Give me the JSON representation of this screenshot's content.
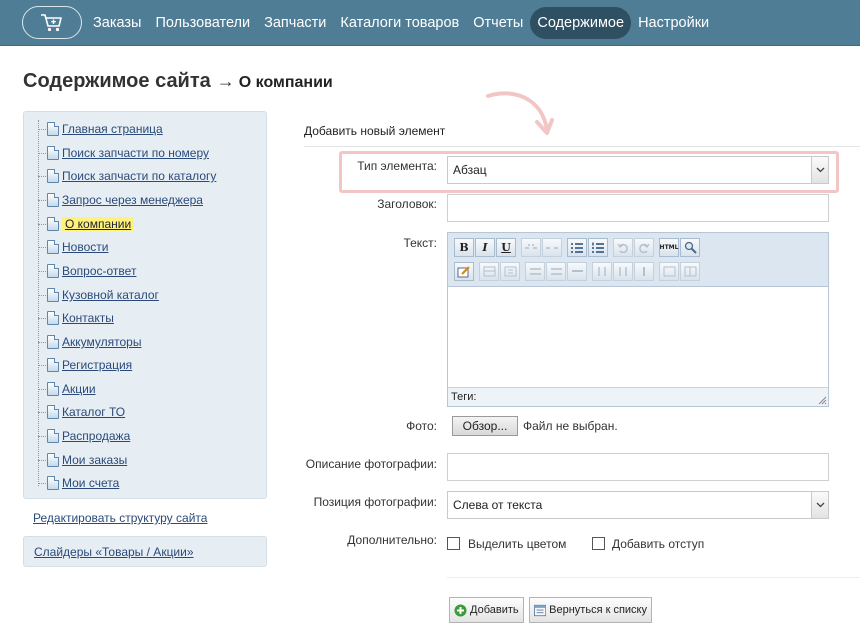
{
  "nav": {
    "cart_icon": "cart-icon",
    "items": [
      {
        "label": "Заказы",
        "active": false
      },
      {
        "label": "Пользователи",
        "active": false
      },
      {
        "label": "Запчасти",
        "active": false
      },
      {
        "label": "Каталоги товаров",
        "active": false
      },
      {
        "label": "Отчеты",
        "active": false
      },
      {
        "label": "Содержимое",
        "active": true
      },
      {
        "label": "Настройки",
        "active": false
      }
    ]
  },
  "title": {
    "main": "Содержимое сайта",
    "arrow": "→",
    "sub": "О компании"
  },
  "sidebar": {
    "tree": [
      {
        "label": "Главная страница"
      },
      {
        "label": "Поиск запчасти по номеру"
      },
      {
        "label": "Поиск запчасти по каталогу"
      },
      {
        "label": "Запрос через менеджера"
      },
      {
        "label": "О компании",
        "current": true
      },
      {
        "label": "Новости"
      },
      {
        "label": "Вопрос-ответ"
      },
      {
        "label": "Кузовной каталог"
      },
      {
        "label": "Контакты"
      },
      {
        "label": "Аккумуляторы"
      },
      {
        "label": "Регистрация"
      },
      {
        "label": "Акции"
      },
      {
        "label": "Каталог ТО"
      },
      {
        "label": "Распродажа"
      },
      {
        "label": "Мои заказы"
      },
      {
        "label": "Мои счета"
      }
    ],
    "edit_structure": "Редактировать структуру сайта",
    "sliders": "Слайдеры «Товары / Акции»"
  },
  "form": {
    "heading": "Добавить новый элемент",
    "type_label": "Тип элемента:",
    "type_value": "Абзац",
    "heading_label": "Заголовок:",
    "heading_value": "",
    "text_label": "Текст:",
    "editor": {
      "bold": "B",
      "italic": "I",
      "underline": "U",
      "html": "HTML",
      "status_label": "Теги:"
    },
    "photo_label": "Фото:",
    "photo_button": "Обзор...",
    "photo_status": "Файл не выбран.",
    "photo_desc_label": "Описание фотографии:",
    "photo_desc_value": "",
    "photo_pos_label": "Позиция фотографии:",
    "photo_pos_value": "Слева от текста",
    "extra_label": "Дополнительно:",
    "checkbox_color": "Выделить цветом",
    "checkbox_indent": "Добавить отступ",
    "add_button": "Добавить",
    "back_button": "Вернуться к списку"
  },
  "colors": {
    "nav_bg": "#4f7d96",
    "nav_active": "#2f4f62",
    "highlight": "#fff27a",
    "annotation": "#f3c6c6"
  }
}
